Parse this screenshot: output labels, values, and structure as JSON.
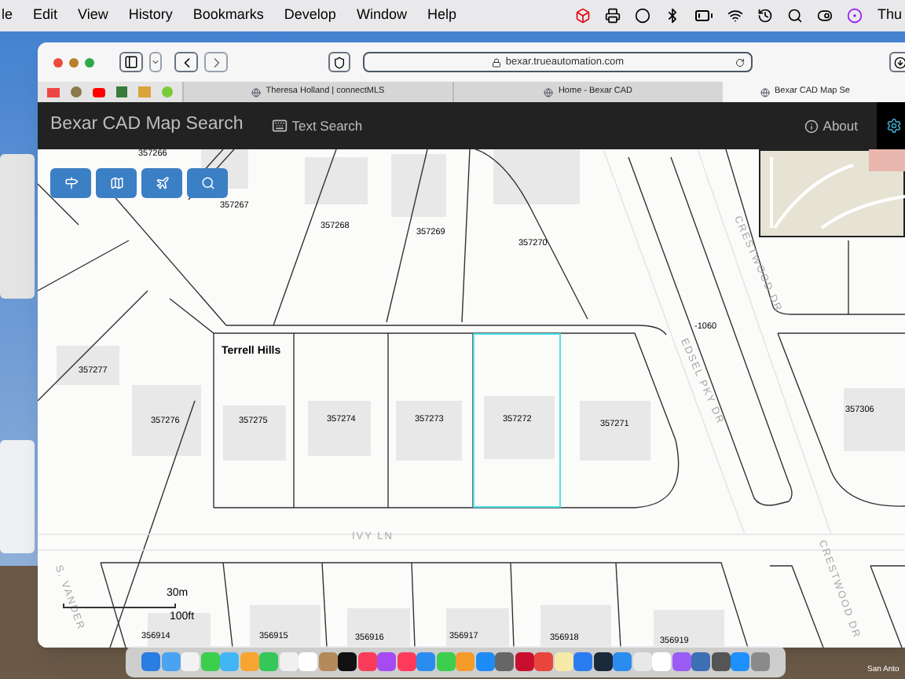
{
  "menu_bar": {
    "items": [
      "le",
      "Edit",
      "View",
      "History",
      "Bookmarks",
      "Develop",
      "Window",
      "Help"
    ],
    "clock": "Thu"
  },
  "browser": {
    "address": "bexar.trueautomation.com",
    "tabs": [
      {
        "label": "Theresa Holland | connectMLS",
        "selected": false
      },
      {
        "label": "Home - Bexar CAD",
        "selected": false
      },
      {
        "label": "Bexar CAD Map Se",
        "selected": true
      }
    ]
  },
  "app": {
    "title": "Bexar CAD Map Search",
    "text_search": "Text Search",
    "about": "About"
  },
  "map": {
    "area_label": "Terrell Hills",
    "parcels": [
      {
        "label": "357266",
        "selected": false
      },
      {
        "label": "357267",
        "selected": false
      },
      {
        "label": "357268",
        "selected": false
      },
      {
        "label": "357269",
        "selected": false
      },
      {
        "label": "357270",
        "selected": false
      },
      {
        "label": "357277",
        "selected": false
      },
      {
        "label": "357276",
        "selected": false
      },
      {
        "label": "357275",
        "selected": false
      },
      {
        "label": "357274",
        "selected": false
      },
      {
        "label": "357273",
        "selected": false
      },
      {
        "label": "357272",
        "selected": true
      },
      {
        "label": "357271",
        "selected": false
      },
      {
        "label": "357306",
        "selected": false
      },
      {
        "label": "-1060",
        "selected": false
      },
      {
        "label": "356914",
        "selected": false
      },
      {
        "label": "356915",
        "selected": false
      },
      {
        "label": "356916",
        "selected": false
      },
      {
        "label": "356917",
        "selected": false
      },
      {
        "label": "356918",
        "selected": false
      },
      {
        "label": "356919",
        "selected": false
      }
    ],
    "streets": [
      "CRESTWOOD DR",
      "EDSEL PKY DR",
      "IVY LN",
      "S. VANDER",
      "CRESTWOOD DR"
    ],
    "scale": {
      "metric": "30m",
      "imperial": "100ft"
    }
  },
  "desktop": {
    "caption": "San Anto"
  }
}
